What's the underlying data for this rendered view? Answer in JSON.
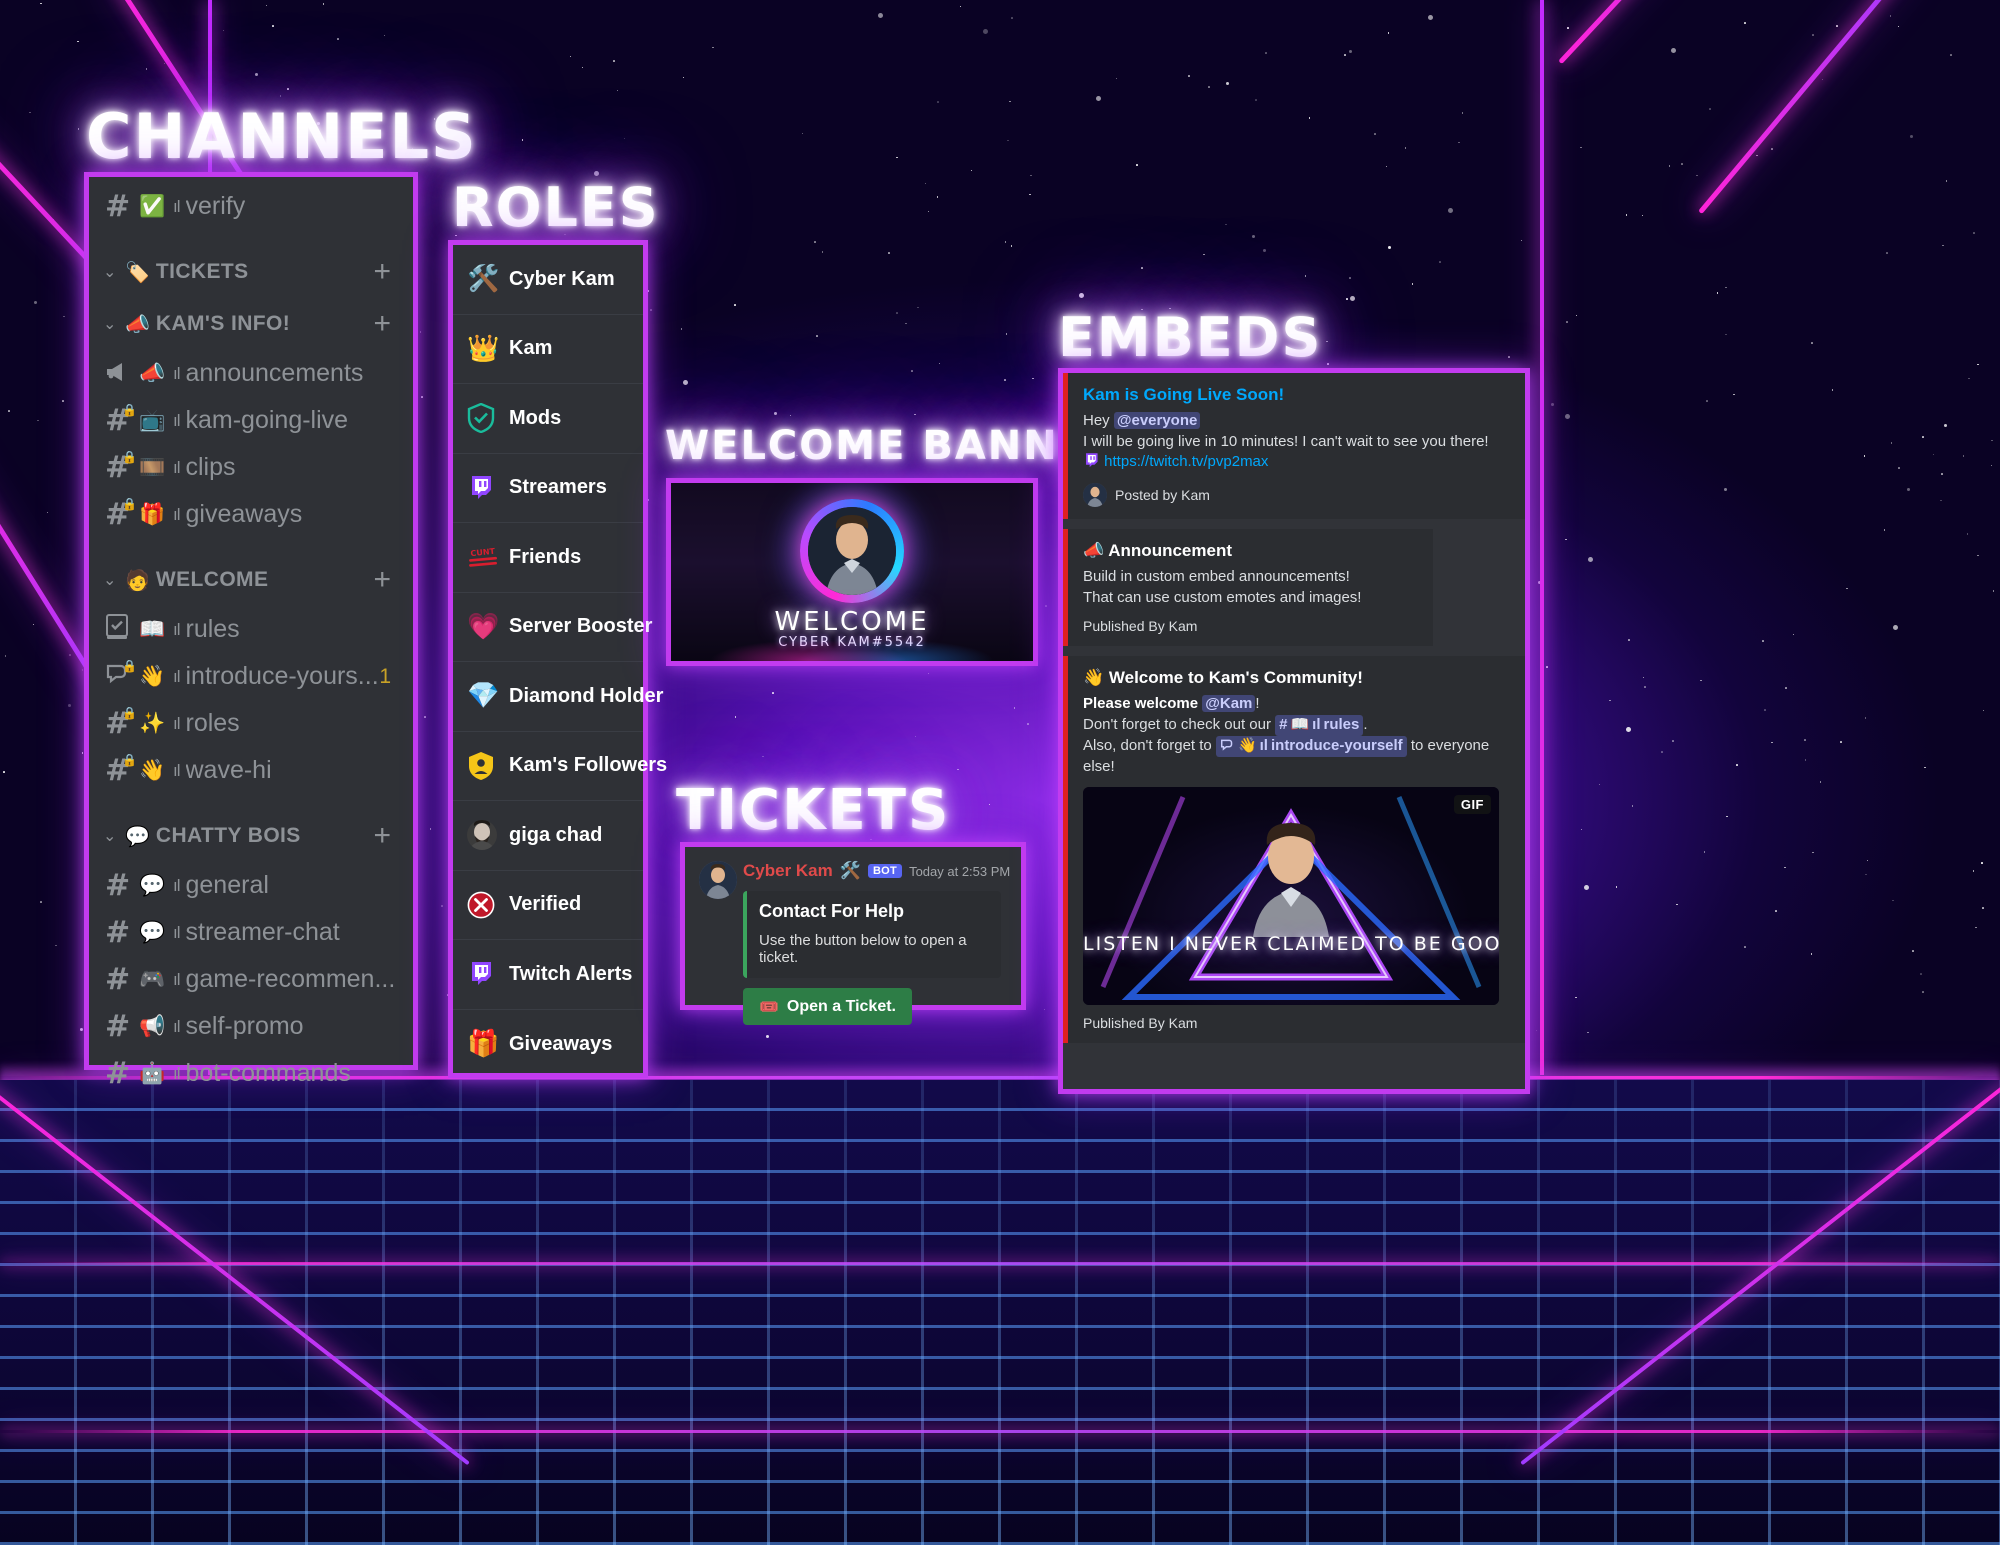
{
  "headings": {
    "channels": "CHANNELS",
    "roles": "ROLES",
    "welcome_banner": "WELCOME BANNER",
    "tickets": "TICKETS",
    "embeds": "EMBEDS"
  },
  "channels": {
    "top_channel": {
      "icon": "hash-icon",
      "emoji": "✅",
      "bars": "ıl",
      "name": "verify",
      "locked": false
    },
    "categories": [
      {
        "emoji": "🏷️",
        "name": "TICKETS",
        "channels": []
      },
      {
        "emoji": "📣",
        "name": "KAM'S INFO!",
        "channels": [
          {
            "icon": "announcement-icon",
            "emoji": "📣",
            "bars": "ıl",
            "name": "announcements",
            "locked": false
          },
          {
            "icon": "hash-icon",
            "emoji": "📺",
            "bars": "ıl",
            "name": "kam-going-live",
            "locked": true
          },
          {
            "icon": "hash-icon",
            "emoji": "🎞️",
            "bars": "ıl",
            "name": "clips",
            "locked": true
          },
          {
            "icon": "hash-icon",
            "emoji": "🎁",
            "bars": "ıl",
            "name": "giveaways",
            "locked": true
          }
        ]
      },
      {
        "emoji": "🧑",
        "name": "WELCOME",
        "channels": [
          {
            "icon": "rules-icon",
            "emoji": "📖",
            "bars": "ıl",
            "name": "rules",
            "locked": false
          },
          {
            "icon": "forum-icon",
            "emoji": "👋",
            "bars": "ıl",
            "name": "introduce-yours...",
            "locked": true,
            "badge": "1"
          },
          {
            "icon": "hash-icon",
            "emoji": "✨",
            "bars": "ıl",
            "name": "roles",
            "locked": true
          },
          {
            "icon": "hash-icon",
            "emoji": "👋",
            "bars": "ıl",
            "name": "wave-hi",
            "locked": true
          }
        ]
      },
      {
        "emoji": "💬",
        "name": "CHATTY BOIS",
        "channels": [
          {
            "icon": "hash-icon",
            "emoji": "💬",
            "bars": "ıl",
            "name": "general",
            "locked": false
          },
          {
            "icon": "hash-icon",
            "emoji": "💬",
            "bars": "ıl",
            "name": "streamer-chat",
            "locked": false
          },
          {
            "icon": "hash-icon",
            "emoji": "🎮",
            "bars": "ıl",
            "name": "game-recommen...",
            "locked": false
          },
          {
            "icon": "hash-icon",
            "emoji": "📢",
            "bars": "ıl",
            "name": "self-promo",
            "locked": false
          },
          {
            "icon": "hash-icon",
            "emoji": "🤖",
            "bars": "ıl",
            "name": "bot-commands",
            "locked": false
          }
        ]
      }
    ],
    "add_label": "+"
  },
  "roles": [
    {
      "icon": "tools-icon",
      "emoji": "🛠️",
      "name": "Cyber Kam"
    },
    {
      "icon": "crown-icon",
      "emoji": "👑",
      "name": "Kam"
    },
    {
      "icon": "shield-check-icon",
      "emoji": "🛡️",
      "name": "Mods"
    },
    {
      "icon": "twitch-icon",
      "emoji": "",
      "name": "Streamers"
    },
    {
      "icon": "cunt-stamp-icon",
      "emoji": "",
      "name": "Friends"
    },
    {
      "icon": "heart-icon",
      "emoji": "💗",
      "name": "Server Booster"
    },
    {
      "icon": "diamond-icon",
      "emoji": "💎",
      "name": "Diamond Holder"
    },
    {
      "icon": "person-badge-icon",
      "emoji": "",
      "name": "Kam's Followers"
    },
    {
      "icon": "gigachad-avatar-icon",
      "emoji": "",
      "name": "giga chad"
    },
    {
      "icon": "verified-icon",
      "emoji": "",
      "name": "Verified"
    },
    {
      "icon": "twitch-alerts-icon",
      "emoji": "",
      "name": "Twitch Alerts"
    },
    {
      "icon": "gift-icon",
      "emoji": "🎁",
      "name": "Giveaways"
    }
  ],
  "banner": {
    "welcome_text": "WELCOME",
    "username_tag": "CYBER KAM#5542"
  },
  "ticket": {
    "username": "Cyber Kam",
    "role_emoji": "🛠️",
    "bot_tag": "BOT",
    "timestamp": "Today at 2:53 PM",
    "embed_title": "Contact For Help",
    "embed_desc": "Use the button below to open a ticket.",
    "button_emoji": "🎟️",
    "button_label": "Open a Ticket.",
    "accent_color": "#3ba55d"
  },
  "embeds": [
    {
      "title": "Kam is Going Live Soon!",
      "title_color": "#00a8fc",
      "accent_color": "#e02020",
      "lines": [
        {
          "prefix": "Hey ",
          "mention": "@everyone",
          "suffix": ""
        },
        {
          "text": "I will be going live in 10 minutes! I can't wait to see you there!"
        },
        {
          "twitch": true,
          "link": "https://twitch.tv/pvp2max"
        }
      ],
      "footer": "Posted by Kam"
    },
    {
      "title_emoji": "📣",
      "title": "Announcement",
      "title_color": "#ffffff",
      "accent_color": "#e02020",
      "lines": [
        {
          "text": "Build in custom embed announcements!"
        },
        {
          "text": "That can use custom emotes and images!"
        }
      ],
      "footer_plain": "Published By Kam"
    },
    {
      "title_emoji": "👋",
      "title": "Welcome to Kam's Community!",
      "title_color": "#ffffff",
      "accent_color": "#e02020",
      "lines": [
        {
          "bold": "Please welcome ",
          "mention": "@Kam",
          "suffix": "!"
        },
        {
          "prefix": "Don't forget to check out our ",
          "chip": {
            "hash": "#",
            "emoji": "📖",
            "bars": "ıl",
            "name": "rules"
          },
          "suffix": "."
        },
        {
          "prefix": "Also, don't forget to ",
          "chip": {
            "hash": "",
            "emoji": "👋",
            "bars": "ıl",
            "name": "introduce-yourself",
            "forum": true
          },
          "suffix": " to everyone else!"
        }
      ],
      "gif": {
        "badge": "GIF",
        "caption": "LISTEN I NEVER CLAIMED TO BE GOOD.."
      },
      "footer_plain": "Published By Kam"
    }
  ],
  "colors": {
    "panel_border": "#c23bef",
    "panel_bg": "#2f3136",
    "channel_text": "#8e9297",
    "embed_bg": "#2b2d31"
  }
}
